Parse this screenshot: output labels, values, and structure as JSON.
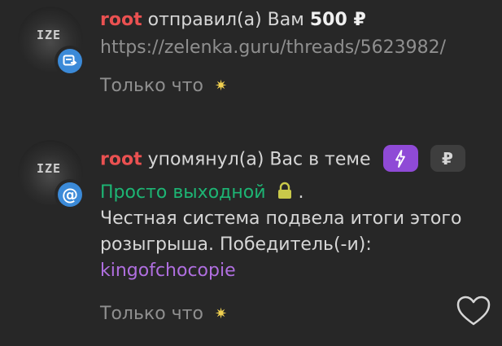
{
  "notifications": [
    {
      "avatar_text": "IZE",
      "user": "root",
      "action": "отправил(а) Вам",
      "amount": "500 ₽",
      "link": "https://zelenka.guru/threads/5623982/",
      "time": "Только что",
      "badge_icon": "transfer-icon"
    },
    {
      "avatar_text": "IZE",
      "user": "root",
      "action": "упомянул(а) Вас в теме",
      "thread_title": "Просто выходной",
      "after_title": ".",
      "text_line1": "Честная система подвела итоги этого",
      "text_line2": "розыгрыша. Победитель(-и):",
      "winner": "kingofchocopie",
      "ruble_badge": "₽",
      "time": "Только что",
      "badge_icon": "at-icon"
    }
  ],
  "colors": {
    "background": "#272727",
    "username": "#ea5151",
    "thread": "#1db574",
    "winner": "#b06fe0",
    "badge_blue": "#3b8ad8",
    "lightning_pill": "#8f4ad6"
  }
}
